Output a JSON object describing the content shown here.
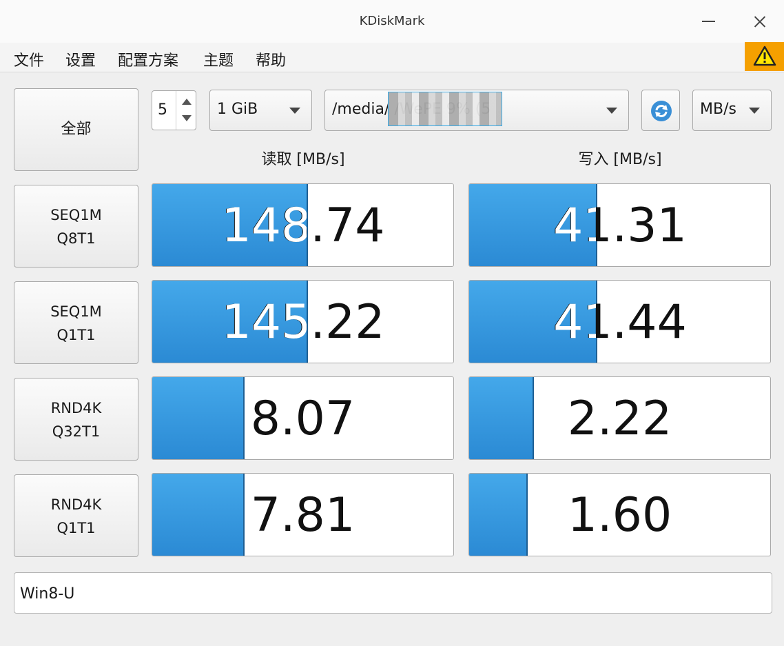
{
  "window": {
    "title": "KDiskMark"
  },
  "menu": [
    "文件",
    "设置",
    "配置方案",
    "主题",
    "帮助"
  ],
  "toolbar": {
    "all_button": "全部",
    "runs": "5",
    "size": "1 GiB",
    "path": "/media/                     /WePE 9% (5",
    "unit": "MB/s"
  },
  "columns": {
    "read": "读取 [MB/s]",
    "write": "写入 [MB/s]"
  },
  "tests": [
    {
      "line1": "SEQ1M",
      "line2": "Q8T1",
      "read": "148.74",
      "write": "41.31",
      "read_fill": 0.51,
      "write_fill": 0.42
    },
    {
      "line1": "SEQ1M",
      "line2": "Q1T1",
      "read": "145.22",
      "write": "41.44",
      "read_fill": 0.51,
      "write_fill": 0.42
    },
    {
      "line1": "RND4K",
      "line2": "Q32T1",
      "read": "8.07",
      "write": "2.22",
      "read_fill": 0.3,
      "write_fill": 0.21
    },
    {
      "line1": "RND4K",
      "line2": "Q1T1",
      "read": "7.81",
      "write": "1.60",
      "read_fill": 0.3,
      "write_fill": 0.19
    }
  ],
  "comment": "Win8-U",
  "colors": {
    "bar": "#2f93dc",
    "warning": "#f5a000"
  }
}
